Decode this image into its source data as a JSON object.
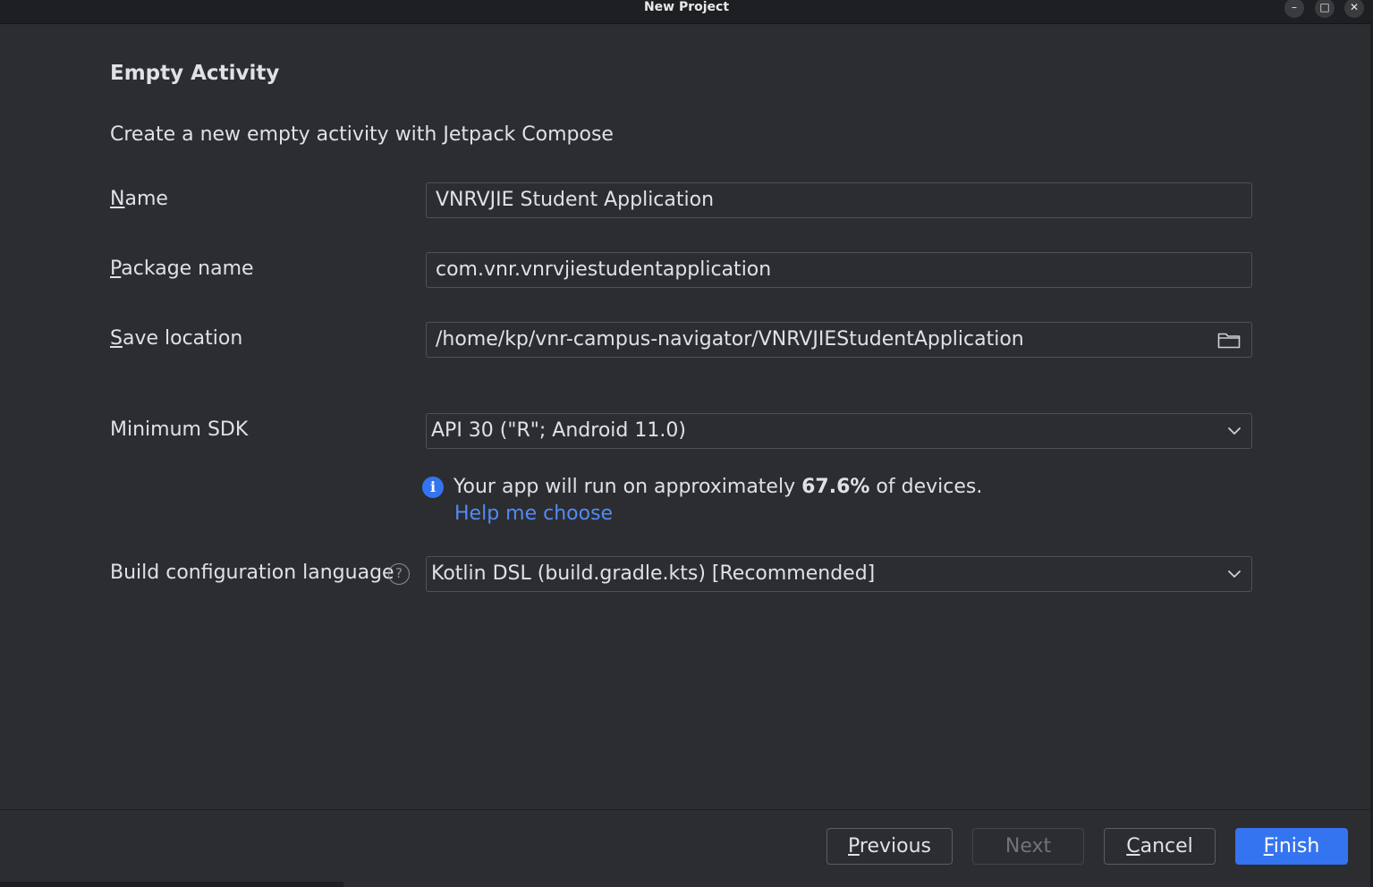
{
  "window": {
    "title": "New Project",
    "minimize_glyph": "–",
    "maximize_glyph": "□",
    "close_glyph": "✕"
  },
  "page": {
    "title": "Empty Activity",
    "description": "Create a new empty activity with Jetpack Compose"
  },
  "form": {
    "name": {
      "label_first": "N",
      "label_rest": "ame",
      "value": "VNRVJIE Student Application"
    },
    "package_name": {
      "label_first": "P",
      "label_rest": "ackage name",
      "value": "com.vnr.vnrvjiestudentapplication"
    },
    "save_location": {
      "label_first": "S",
      "label_rest": "ave location",
      "value": "/home/kp/vnr-campus-navigator/VNRVJIEStudentApplication",
      "icon": "folder-icon"
    },
    "minimum_sdk": {
      "label": "Minimum SDK",
      "selected": "API 30 (\"R\"; Android 11.0)",
      "icon": "chevron-down-icon"
    },
    "info": {
      "icon": "info-icon",
      "icon_glyph": "i",
      "text_before": "Your app will run on approximately ",
      "percent": "67.6%",
      "text_after": " of devices.",
      "link": "Help me choose"
    },
    "build_language": {
      "label": "Build configuration language",
      "help_glyph": "?",
      "selected": "Kotlin DSL (build.gradle.kts) [Recommended]",
      "icon": "chevron-down-icon"
    }
  },
  "footer": {
    "previous": {
      "first": "P",
      "rest": "revious"
    },
    "next": "Next",
    "cancel": {
      "first": "C",
      "rest": "ancel"
    },
    "finish": {
      "first": "F",
      "rest": "inish"
    }
  },
  "colors": {
    "background": "#2b2d30",
    "titlebar": "#1e1f22",
    "accent": "#3574f0",
    "link": "#548af7",
    "border": "#4e5157",
    "text": "#dfe1e5"
  }
}
